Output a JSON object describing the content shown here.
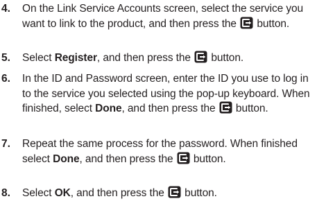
{
  "steps": [
    {
      "number": "4.",
      "parts": [
        "On the Link Service Accounts screen, select the service you want to link to the product, and then press the ",
        " button."
      ]
    },
    {
      "number": "5.",
      "parts": [
        "Select ",
        "Register",
        ", and then press the ",
        " button."
      ]
    },
    {
      "number": "6.",
      "parts": [
        "In the ID and Password screen, enter the ID you use to log in to the service you selected using the pop-up keyboard. When finished, select ",
        "Done",
        ", and then press the ",
        " button."
      ]
    },
    {
      "number": "7.",
      "parts": [
        "Repeat the same process for the password. When finished select ",
        "Done",
        ", and then press the ",
        " button."
      ]
    },
    {
      "number": "8.",
      "parts": [
        "Select ",
        "OK",
        ", and then press the ",
        " button."
      ]
    }
  ],
  "icon": "enter-button-icon",
  "colors": {
    "text": "#231f20",
    "icon_fill": "#231f20",
    "icon_glyph": "#ffffff"
  }
}
